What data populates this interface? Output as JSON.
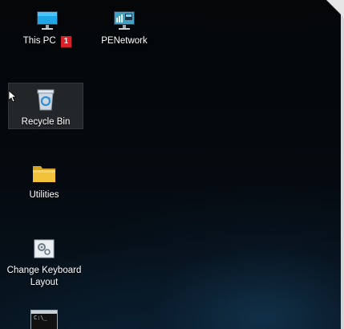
{
  "desktop": {
    "icons": [
      {
        "label": "This PC",
        "icon": "monitor-icon"
      },
      {
        "label": "PENetwork",
        "icon": "network-monitor-icon"
      },
      {
        "label": "Recycle Bin",
        "icon": "recycle-bin-icon"
      },
      {
        "label": "Utilities",
        "icon": "folder-icon"
      },
      {
        "label": "Change Keyboard Layout",
        "icon": "keyboard-settings-icon"
      },
      {
        "label": "",
        "icon": "command-prompt-icon"
      }
    ],
    "callout_badge": "1",
    "selected_icon": "Recycle Bin",
    "cmd_glyph_text": "C:\\_"
  },
  "colors": {
    "badge": "#d8222a",
    "selection": "rgba(255,255,255,0.12)",
    "monitor_screen": "#1fa6e6",
    "folder": "#f2c23a"
  }
}
